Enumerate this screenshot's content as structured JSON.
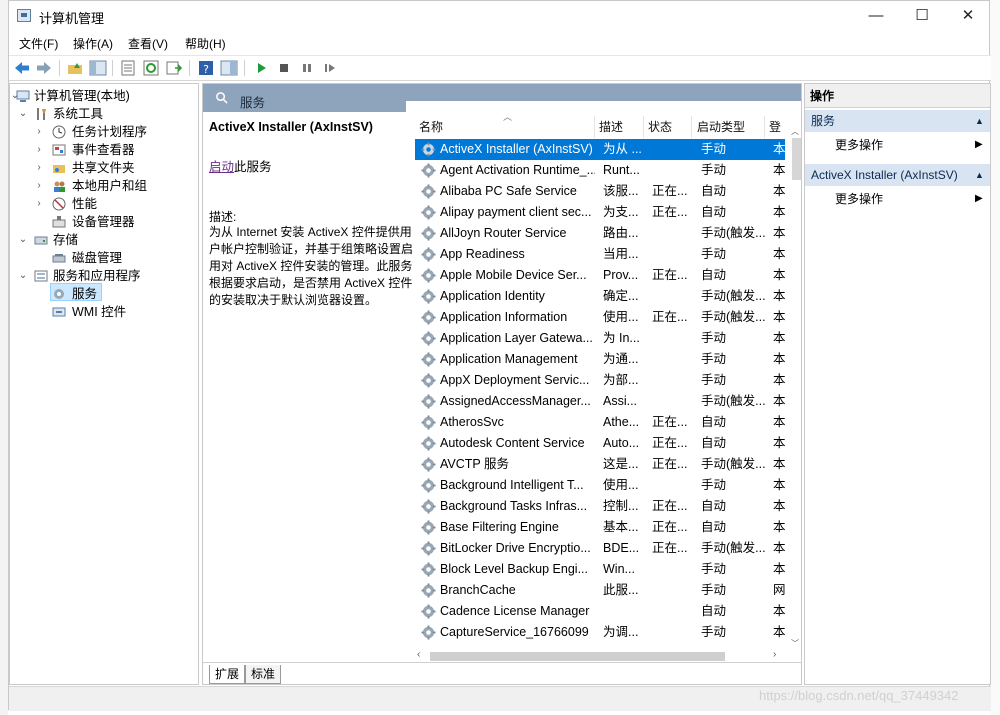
{
  "window": {
    "title": "计算机管理",
    "minimize": "—",
    "maximize": "☐",
    "close": "✕"
  },
  "menu": [
    "文件(F)",
    "操作(A)",
    "查看(V)",
    "帮助(H)"
  ],
  "tree": {
    "root": "计算机管理(本地)",
    "system_tools": "系统工具",
    "task_scheduler": "任务计划程序",
    "event_viewer": "事件查看器",
    "shared_folders": "共享文件夹",
    "local_users": "本地用户和组",
    "performance": "性能",
    "device_manager": "设备管理器",
    "storage": "存储",
    "disk_management": "磁盘管理",
    "services_apps": "服务和应用程序",
    "services": "服务",
    "wmi": "WMI 控件"
  },
  "center": {
    "header_title": "服务",
    "selected_name": "ActiveX Installer (AxInstSV)",
    "start_link": "启动",
    "start_suffix": "此服务",
    "desc_label": "描述:",
    "desc_text": "为从 Internet 安装 ActiveX 控件提供用户帐户控制验证，并基于组策略设置启用对 ActiveX 控件安装的管理。此服务根据要求启动，是否禁用 ActiveX 控件的安装取决于默认浏览器设置。",
    "columns": [
      "名称",
      "描述",
      "状态",
      "启动类型",
      "登"
    ],
    "tabs": [
      "扩展",
      "标准"
    ]
  },
  "services": [
    {
      "name": "ActiveX Installer (AxInstSV)",
      "desc": "为从 ...",
      "status": "",
      "startup": "手动",
      "logon": "本"
    },
    {
      "name": "Agent Activation Runtime_...",
      "desc": "Runt...",
      "status": "",
      "startup": "手动",
      "logon": "本"
    },
    {
      "name": "Alibaba PC Safe Service",
      "desc": "该服...",
      "status": "正在...",
      "startup": "自动",
      "logon": "本"
    },
    {
      "name": "Alipay payment client sec...",
      "desc": "为支...",
      "status": "正在...",
      "startup": "自动",
      "logon": "本"
    },
    {
      "name": "AllJoyn Router Service",
      "desc": "路由...",
      "status": "",
      "startup": "手动(触发...",
      "logon": "本"
    },
    {
      "name": "App Readiness",
      "desc": "当用...",
      "status": "",
      "startup": "手动",
      "logon": "本"
    },
    {
      "name": "Apple Mobile Device Ser...",
      "desc": "Prov...",
      "status": "正在...",
      "startup": "自动",
      "logon": "本"
    },
    {
      "name": "Application Identity",
      "desc": "确定...",
      "status": "",
      "startup": "手动(触发...",
      "logon": "本"
    },
    {
      "name": "Application Information",
      "desc": "使用...",
      "status": "正在...",
      "startup": "手动(触发...",
      "logon": "本"
    },
    {
      "name": "Application Layer Gatewa...",
      "desc": "为 In...",
      "status": "",
      "startup": "手动",
      "logon": "本"
    },
    {
      "name": "Application Management",
      "desc": "为通...",
      "status": "",
      "startup": "手动",
      "logon": "本"
    },
    {
      "name": "AppX Deployment Servic...",
      "desc": "为部...",
      "status": "",
      "startup": "手动",
      "logon": "本"
    },
    {
      "name": "AssignedAccessManager...",
      "desc": "Assi...",
      "status": "",
      "startup": "手动(触发...",
      "logon": "本"
    },
    {
      "name": "AtherosSvc",
      "desc": "Athe...",
      "status": "正在...",
      "startup": "自动",
      "logon": "本"
    },
    {
      "name": "Autodesk Content Service",
      "desc": "Auto...",
      "status": "正在...",
      "startup": "自动",
      "logon": "本"
    },
    {
      "name": "AVCTP 服务",
      "desc": "这是...",
      "status": "正在...",
      "startup": "手动(触发...",
      "logon": "本"
    },
    {
      "name": "Background Intelligent T...",
      "desc": "使用...",
      "status": "",
      "startup": "手动",
      "logon": "本"
    },
    {
      "name": "Background Tasks Infras...",
      "desc": "控制...",
      "status": "正在...",
      "startup": "自动",
      "logon": "本"
    },
    {
      "name": "Base Filtering Engine",
      "desc": "基本...",
      "status": "正在...",
      "startup": "自动",
      "logon": "本"
    },
    {
      "name": "BitLocker Drive Encryptio...",
      "desc": "BDE...",
      "status": "正在...",
      "startup": "手动(触发...",
      "logon": "本"
    },
    {
      "name": "Block Level Backup Engi...",
      "desc": "Win...",
      "status": "",
      "startup": "手动",
      "logon": "本"
    },
    {
      "name": "BranchCache",
      "desc": "此服...",
      "status": "",
      "startup": "手动",
      "logon": "网"
    },
    {
      "name": "Cadence License Manager",
      "desc": "",
      "status": "",
      "startup": "自动",
      "logon": "本"
    },
    {
      "name": "CaptureService_16766099",
      "desc": "为调...",
      "status": "",
      "startup": "手动",
      "logon": "本"
    }
  ],
  "actions": {
    "title": "操作",
    "section1": "服务",
    "more1": "更多操作",
    "section2": "ActiveX Installer (AxInstSV)",
    "more2": "更多操作"
  },
  "watermark": "https://blog.csdn.net/qq_37449342",
  "colors": {
    "selection": "#0078d7",
    "header": "#8ea4bc",
    "accent_section": "#d8e4f1"
  }
}
